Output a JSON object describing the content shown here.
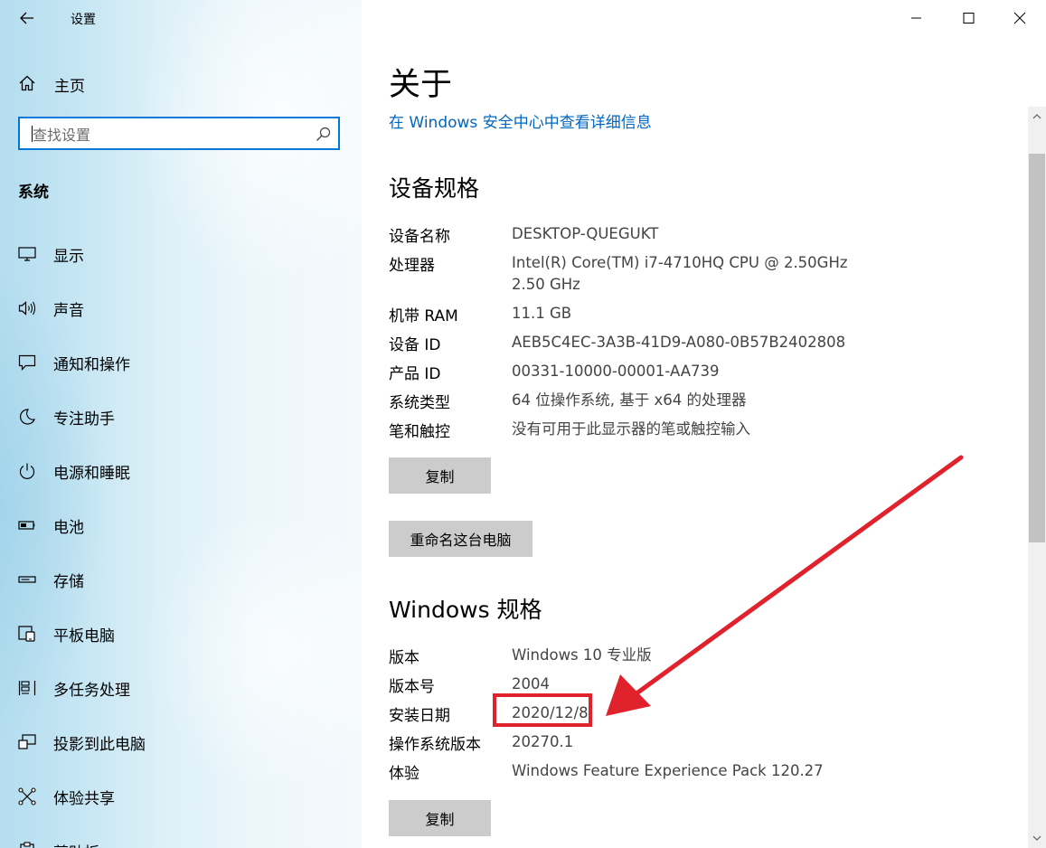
{
  "window": {
    "app_title": "设置",
    "controls": {
      "minimize": "minimize",
      "maximize": "maximize",
      "close": "close"
    }
  },
  "sidebar": {
    "home_label": "主页",
    "search_placeholder": "查找设置",
    "section_label": "系统",
    "items": [
      {
        "label": "显示",
        "icon": "display-icon"
      },
      {
        "label": "声音",
        "icon": "speaker-icon"
      },
      {
        "label": "通知和操作",
        "icon": "notification-icon"
      },
      {
        "label": "专注助手",
        "icon": "moon-icon"
      },
      {
        "label": "电源和睡眠",
        "icon": "power-icon"
      },
      {
        "label": "电池",
        "icon": "battery-icon"
      },
      {
        "label": "存储",
        "icon": "storage-icon"
      },
      {
        "label": "平板电脑",
        "icon": "tablet-icon"
      },
      {
        "label": "多任务处理",
        "icon": "multitask-icon"
      },
      {
        "label": "投影到此电脑",
        "icon": "projection-icon"
      },
      {
        "label": "体验共享",
        "icon": "share-icon"
      },
      {
        "label": "剪贴板",
        "icon": "clipboard-icon"
      }
    ]
  },
  "main": {
    "title": "关于",
    "security_link": "在 Windows 安全中心中查看详细信息",
    "device_specs": {
      "heading": "设备规格",
      "rows": [
        {
          "key": "设备名称",
          "value": "DESKTOP-QUEGUKT"
        },
        {
          "key": "处理器",
          "value": "Intel(R) Core(TM) i7-4710HQ CPU @ 2.50GHz   2.50 GHz"
        },
        {
          "key": "机带 RAM",
          "value": "11.1 GB"
        },
        {
          "key": "设备 ID",
          "value": "AEB5C4EC-3A3B-41D9-A080-0B57B2402808"
        },
        {
          "key": "产品 ID",
          "value": "00331-10000-00001-AA739"
        },
        {
          "key": "系统类型",
          "value": "64 位操作系统, 基于 x64 的处理器"
        },
        {
          "key": "笔和触控",
          "value": "没有可用于此显示器的笔或触控输入"
        }
      ],
      "copy_button": "复制",
      "rename_button": "重命名这台电脑"
    },
    "windows_specs": {
      "heading": "Windows 规格",
      "rows": [
        {
          "key": "版本",
          "value": "Windows 10 专业版"
        },
        {
          "key": "版本号",
          "value": "2004"
        },
        {
          "key": "安装日期",
          "value": "2020/12/8"
        },
        {
          "key": "操作系统版本",
          "value": "20270.1"
        },
        {
          "key": "体验",
          "value": "Windows Feature Experience Pack 120.27"
        }
      ],
      "copy_button": "复制"
    }
  },
  "annotation": {
    "color": "#e0222c",
    "target": "安装日期"
  },
  "colors": {
    "accent": "#0078d7",
    "link": "#0067c0",
    "button_bg": "#cccccc"
  }
}
